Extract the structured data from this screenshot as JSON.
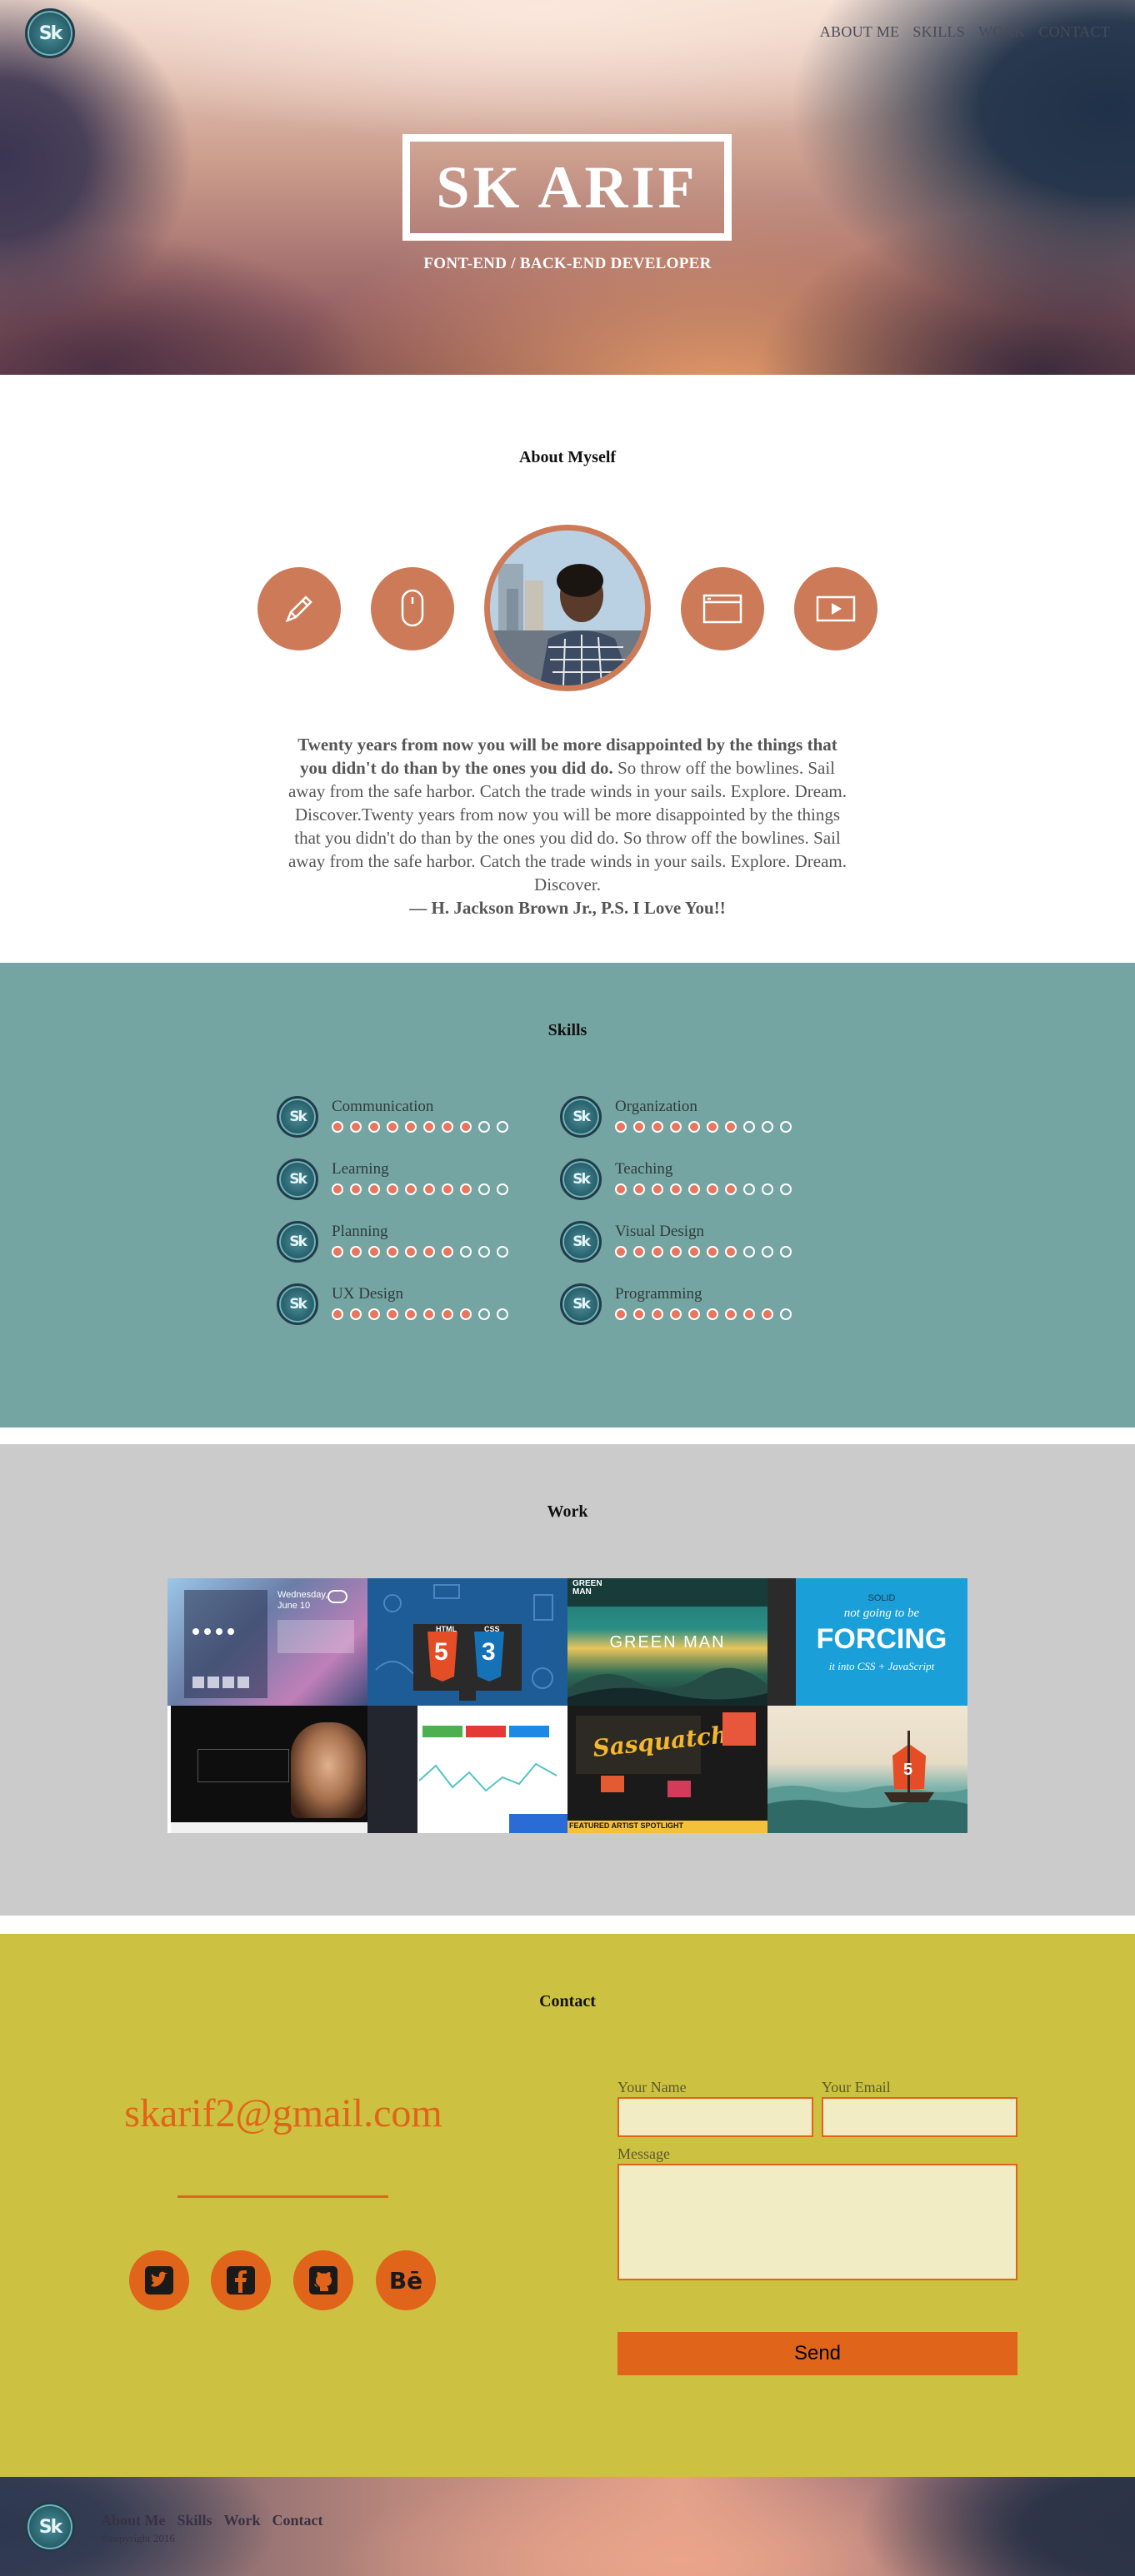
{
  "brand": {
    "logo_text": "Sk"
  },
  "nav": {
    "items": [
      "ABOUT ME",
      "SKILLS",
      "WORK",
      "CONTACT"
    ]
  },
  "hero": {
    "title": "SK ARIF",
    "subtitle": "FONT-END / BACK-END DEVELOPER"
  },
  "about": {
    "heading": "About Myself",
    "icons": [
      "pencil-icon",
      "mouse-icon",
      "browser-window-icon",
      "video-play-icon"
    ],
    "quote_bold": "Twenty years from now you will be more disappointed by the things that you didn't do than by the ones you did do.",
    "quote_body": " So throw off the bowlines. Sail away from the safe harbor. Catch the trade winds in your sails. Explore. Dream. Discover.Twenty years from now you will be more disappointed by the things that you didn't do than by the ones you did do. So throw off the bowlines. Sail away from the safe harbor. Catch the trade winds in your sails. Explore. Dream. Discover.",
    "quote_author": "— H. Jackson Brown Jr., P.S. I Love You!!"
  },
  "skills": {
    "heading": "Skills",
    "max": 10,
    "items": [
      {
        "name": "Communication",
        "level": 8
      },
      {
        "name": "Organization",
        "level": 7
      },
      {
        "name": "Learning",
        "level": 8
      },
      {
        "name": "Teaching",
        "level": 7
      },
      {
        "name": "Planning",
        "level": 7
      },
      {
        "name": "Visual Design",
        "level": 7
      },
      {
        "name": "UX Design",
        "level": 8
      },
      {
        "name": "Programming",
        "level": 9
      }
    ]
  },
  "work": {
    "heading": "Work",
    "tiles": [
      {
        "name": "weather-app"
      },
      {
        "name": "html5-css3"
      },
      {
        "name": "green-man"
      },
      {
        "name": "solid-forcing"
      },
      {
        "name": "fashion-site"
      },
      {
        "name": "dashboard"
      },
      {
        "name": "sasquatch"
      },
      {
        "name": "ship-html5"
      }
    ],
    "texts": {
      "weather_day": "Wednesday,",
      "weather_date": "June 10",
      "html5": "5",
      "css3": "3",
      "html_label": "HTML",
      "css_label": "CSS",
      "green_man_title": "GREEN MAN",
      "green_man_logo": "GREEN\nMAN",
      "solid": "SOLID",
      "not_going": "not going to be",
      "forcing": "FORCING",
      "forcing_sub": "it into CSS + JavaScript",
      "sasquatch": "Sasquatch!",
      "featured": "FEATURED ARTIST SPOTLIGHT",
      "ship_badge": "5"
    }
  },
  "contact": {
    "heading": "Contact",
    "email": "skarif2@gmail.com",
    "social": [
      "twitter-icon",
      "facebook-icon",
      "github-icon",
      "behance-icon"
    ],
    "name_label": "Your Name",
    "email_label": "Your Email",
    "message_label": "Message",
    "send_label": "Send"
  },
  "footer": {
    "links": [
      "About Me",
      "Skills",
      "Work",
      "Contact"
    ],
    "copyright": "©copyright 2016"
  }
}
